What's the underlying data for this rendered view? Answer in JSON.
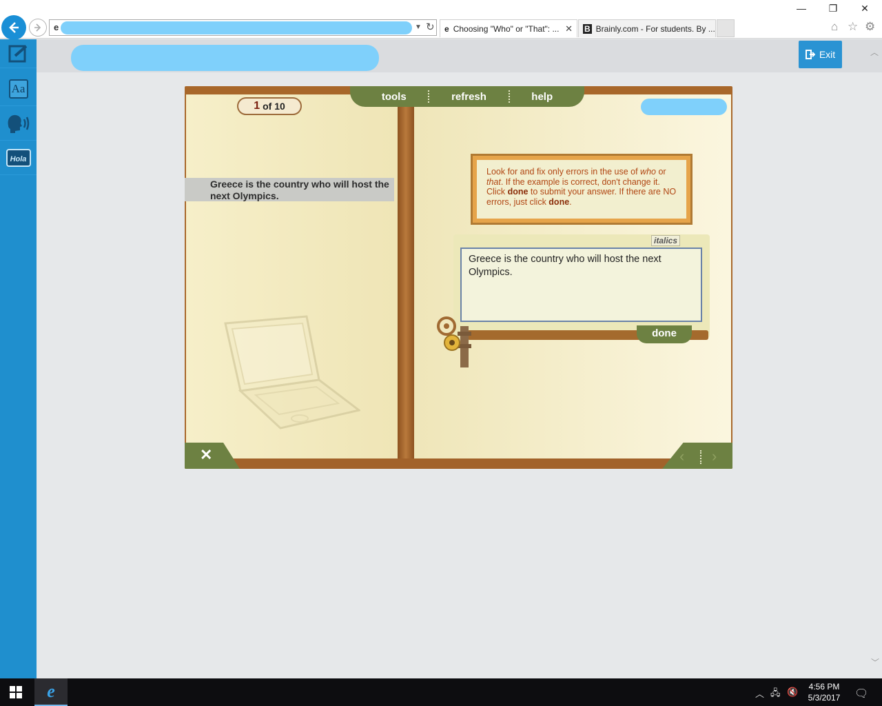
{
  "browser": {
    "tabs": [
      {
        "label": "Choosing \"Who\" or \"That\": ...",
        "favicon": "ie-icon"
      },
      {
        "label": "Brainly.com - For students. By ...",
        "favicon": "brainly-icon"
      }
    ],
    "tab_close": "✕"
  },
  "header": {
    "exit_label": "Exit"
  },
  "rail": {
    "items": [
      "edit-icon",
      "dictionary-icon",
      "speech-icon",
      "translate-icon"
    ],
    "aa_label": "Aa",
    "hola_label": "Hola"
  },
  "activity": {
    "counter": {
      "current": "1",
      "of_label": "of 10"
    },
    "nav": {
      "tools": "tools",
      "refresh": "refresh",
      "help": "help"
    },
    "prompt_sentence": "Greece is the country who will host the next Olympics.",
    "instructions": {
      "t1": "Look for and fix only errors in the use of ",
      "who": "who",
      "t2": " or ",
      "that": "that",
      "t3": ". If the example is correct, don't change it.  Click ",
      "done1": "done",
      "t4": " to submit your answer. If there are NO errors, just click ",
      "done2": "done",
      "t5": "."
    },
    "italics_label": "italics",
    "answer_text": "Greece is the country who will host the next Olympics.",
    "done_label": "done",
    "close_label": "✕",
    "prev_label": "‹",
    "next_label": "›"
  },
  "taskbar": {
    "time": "4:56 PM",
    "date": "5/3/2017"
  },
  "colors": {
    "rail": "#1f8fce",
    "exit": "#2a93d3",
    "nav_green": "#6d8142",
    "wood": "#a8672a"
  }
}
